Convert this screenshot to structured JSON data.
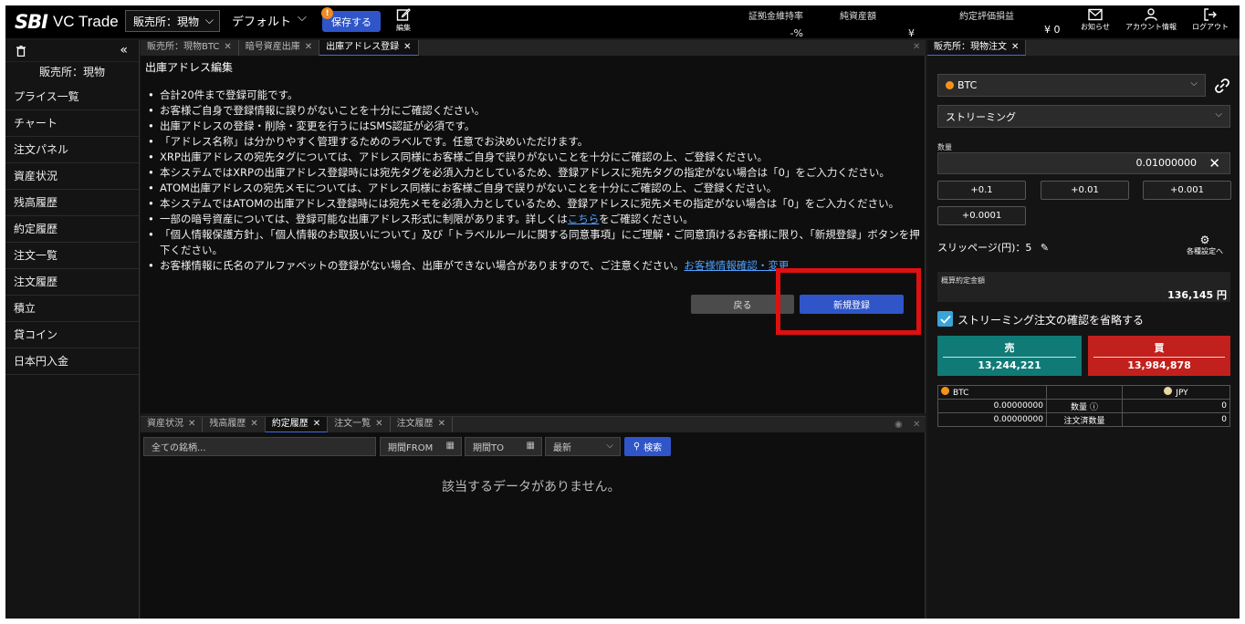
{
  "header": {
    "logo_sbi": "SBI",
    "logo_vct": "VC Trade",
    "market": "販売所：現物",
    "layout": "デフォルト",
    "save_label": "保存する",
    "save_badge": "!",
    "edit_label": "編集",
    "margin_rate_label": "証拠金維持率",
    "margin_rate_value": "-%",
    "net_assets_label": "純資産額",
    "net_assets_value": "¥",
    "unrealized_label": "約定評価損益",
    "yen_total": "¥ 0",
    "notice_label": "お知らせ",
    "account_label": "アカウント情報",
    "logout_label": "ログアウト"
  },
  "sidebar": {
    "market": "販売所：現物",
    "items": [
      {
        "label": "プライス一覧"
      },
      {
        "label": "チャート"
      },
      {
        "label": "注文パネル"
      },
      {
        "label": "資産状況"
      },
      {
        "label": "残高履歴"
      },
      {
        "label": "約定履歴"
      },
      {
        "label": "注文一覧"
      },
      {
        "label": "注文履歴"
      },
      {
        "label": "積立"
      },
      {
        "label": "貸コイン"
      },
      {
        "label": "日本円入金"
      }
    ]
  },
  "center_top": {
    "tabs": [
      {
        "label": "販売所：現物BTC"
      },
      {
        "label": "暗号資産出庫"
      },
      {
        "label": "出庫アドレス登録"
      }
    ],
    "title": "出庫アドレス編集",
    "notes": [
      "合計20件まで登録可能です。",
      "お客様ご自身で登録情報に誤りがないことを十分にご確認ください。",
      "出庫アドレスの登録・削除・変更を行うにはSMS認証が必須です。",
      "「アドレス名称」は分かりやすく管理するためのラベルです。任意でお決めいただけます。",
      "XRP出庫アドレスの宛先タグについては、アドレス同様にお客様ご自身で誤りがないことを十分にご確認の上、ご登録ください。",
      "本システムではXRPの出庫アドレス登録時には宛先タグを必須入力としているため、登録アドレスに宛先タグの指定がない場合は「0」をご入力ください。",
      "ATOM出庫アドレスの宛先メモについては、アドレス同様にお客様ご自身で誤りがないことを十分にご確認の上、ご登録ください。",
      "本システムではATOMの出庫アドレス登録時には宛先メモを必須入力としているため、登録アドレスに宛先メモの指定がない場合は「0」をご入力ください。"
    ],
    "note_link_pre": "一部の暗号資産については、登録可能な出庫アドレス形式に制限があります。詳しくは",
    "note_link": "こちら",
    "note_link_post": "をご確認ください。",
    "note_consent": "「個人情報保護方針」、「個人情報のお取扱いについて」及び「トラベルルールに関する同意事項」にご理解・ご同意頂けるお客様に限り、「新規登録」ボタンを押下ください。",
    "note_name_pre": "お客様情報に氏名のアルファベットの登録がない場合、出庫ができない場合がありますので、ご注意ください。",
    "note_name_link": "お客様情報確認・変更",
    "back_label": "戻る",
    "new_label": "新規登録"
  },
  "center_bottom": {
    "tabs": [
      {
        "label": "資産状況"
      },
      {
        "label": "残高履歴"
      },
      {
        "label": "約定履歴"
      },
      {
        "label": "注文一覧"
      },
      {
        "label": "注文履歴"
      }
    ],
    "symbol_placeholder": "全ての銘柄...",
    "from_label": "期間FROM",
    "to_label": "期間TO",
    "sort_label": "最新",
    "search_label": "検索",
    "no_data": "該当するデータがありません。"
  },
  "right": {
    "tab": "販売所：現物注文",
    "symbol": "BTC",
    "order_type": "ストリーミング",
    "qty_label": "数量",
    "qty_value": "0.01000000",
    "steps": [
      "+0.1",
      "+0.01",
      "+0.001",
      "+0.0001"
    ],
    "slip_label": "スリッページ(円)：5",
    "settings_label": "各種設定へ",
    "estimate_label": "概算約定金額",
    "estimate_value": "136,145 円",
    "skip_confirm_label": "ストリーミング注文の確認を省略する",
    "sell_label": "売",
    "sell_price": "13,244,221",
    "buy_label": "買",
    "buy_price": "13,984,878",
    "balance": {
      "btc_label": "BTC",
      "jpy_label": "JPY",
      "qty_label": "数量",
      "ordered_label": "注文済数量",
      "btc_qty": "0.00000000",
      "btc_ordered": "0.00000000",
      "jpy_qty": "0",
      "jpy_ordered": "0"
    }
  },
  "colors": {
    "accent": "#2f55c9",
    "sell": "#0f7a76",
    "buy": "#c2201c",
    "highlight": "#e01010"
  }
}
